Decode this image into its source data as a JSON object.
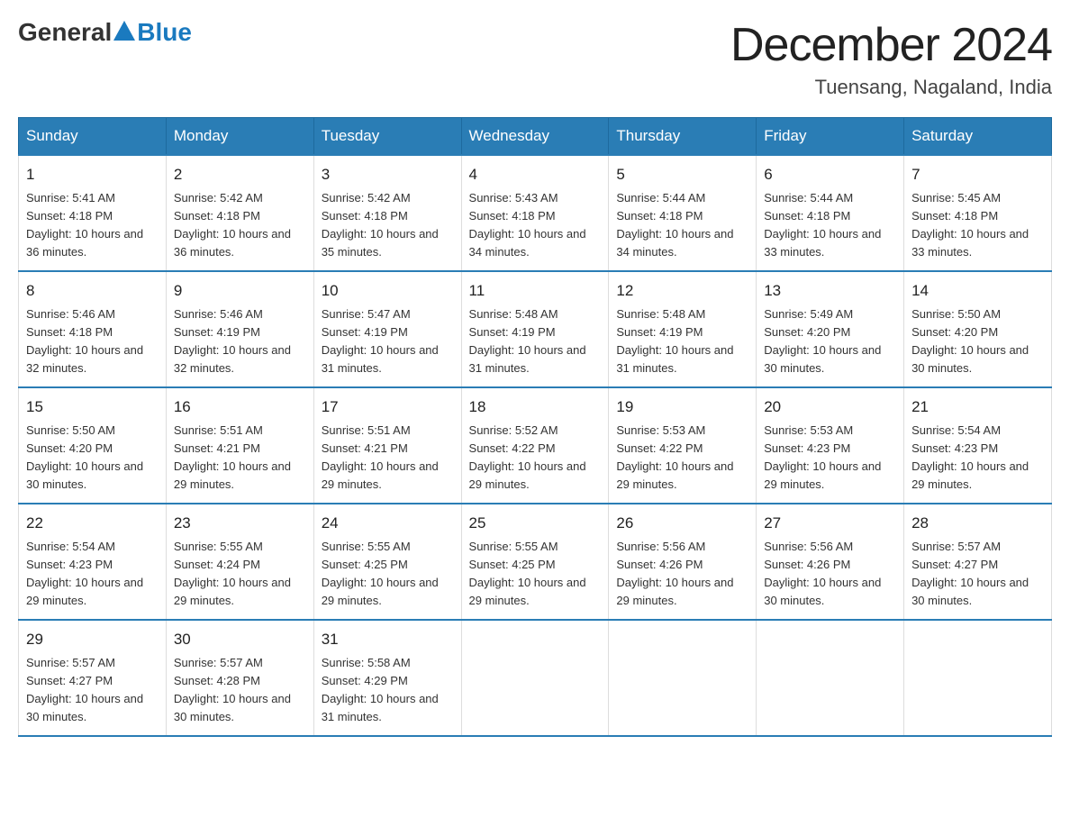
{
  "header": {
    "logo_general": "General",
    "logo_blue": "Blue",
    "month_title": "December 2024",
    "location": "Tuensang, Nagaland, India"
  },
  "weekdays": [
    "Sunday",
    "Monday",
    "Tuesday",
    "Wednesday",
    "Thursday",
    "Friday",
    "Saturday"
  ],
  "weeks": [
    [
      {
        "day": "1",
        "sunrise": "5:41 AM",
        "sunset": "4:18 PM",
        "daylight": "10 hours and 36 minutes."
      },
      {
        "day": "2",
        "sunrise": "5:42 AM",
        "sunset": "4:18 PM",
        "daylight": "10 hours and 36 minutes."
      },
      {
        "day": "3",
        "sunrise": "5:42 AM",
        "sunset": "4:18 PM",
        "daylight": "10 hours and 35 minutes."
      },
      {
        "day": "4",
        "sunrise": "5:43 AM",
        "sunset": "4:18 PM",
        "daylight": "10 hours and 34 minutes."
      },
      {
        "day": "5",
        "sunrise": "5:44 AM",
        "sunset": "4:18 PM",
        "daylight": "10 hours and 34 minutes."
      },
      {
        "day": "6",
        "sunrise": "5:44 AM",
        "sunset": "4:18 PM",
        "daylight": "10 hours and 33 minutes."
      },
      {
        "day": "7",
        "sunrise": "5:45 AM",
        "sunset": "4:18 PM",
        "daylight": "10 hours and 33 minutes."
      }
    ],
    [
      {
        "day": "8",
        "sunrise": "5:46 AM",
        "sunset": "4:18 PM",
        "daylight": "10 hours and 32 minutes."
      },
      {
        "day": "9",
        "sunrise": "5:46 AM",
        "sunset": "4:19 PM",
        "daylight": "10 hours and 32 minutes."
      },
      {
        "day": "10",
        "sunrise": "5:47 AM",
        "sunset": "4:19 PM",
        "daylight": "10 hours and 31 minutes."
      },
      {
        "day": "11",
        "sunrise": "5:48 AM",
        "sunset": "4:19 PM",
        "daylight": "10 hours and 31 minutes."
      },
      {
        "day": "12",
        "sunrise": "5:48 AM",
        "sunset": "4:19 PM",
        "daylight": "10 hours and 31 minutes."
      },
      {
        "day": "13",
        "sunrise": "5:49 AM",
        "sunset": "4:20 PM",
        "daylight": "10 hours and 30 minutes."
      },
      {
        "day": "14",
        "sunrise": "5:50 AM",
        "sunset": "4:20 PM",
        "daylight": "10 hours and 30 minutes."
      }
    ],
    [
      {
        "day": "15",
        "sunrise": "5:50 AM",
        "sunset": "4:20 PM",
        "daylight": "10 hours and 30 minutes."
      },
      {
        "day": "16",
        "sunrise": "5:51 AM",
        "sunset": "4:21 PM",
        "daylight": "10 hours and 29 minutes."
      },
      {
        "day": "17",
        "sunrise": "5:51 AM",
        "sunset": "4:21 PM",
        "daylight": "10 hours and 29 minutes."
      },
      {
        "day": "18",
        "sunrise": "5:52 AM",
        "sunset": "4:22 PM",
        "daylight": "10 hours and 29 minutes."
      },
      {
        "day": "19",
        "sunrise": "5:53 AM",
        "sunset": "4:22 PM",
        "daylight": "10 hours and 29 minutes."
      },
      {
        "day": "20",
        "sunrise": "5:53 AM",
        "sunset": "4:23 PM",
        "daylight": "10 hours and 29 minutes."
      },
      {
        "day": "21",
        "sunrise": "5:54 AM",
        "sunset": "4:23 PM",
        "daylight": "10 hours and 29 minutes."
      }
    ],
    [
      {
        "day": "22",
        "sunrise": "5:54 AM",
        "sunset": "4:23 PM",
        "daylight": "10 hours and 29 minutes."
      },
      {
        "day": "23",
        "sunrise": "5:55 AM",
        "sunset": "4:24 PM",
        "daylight": "10 hours and 29 minutes."
      },
      {
        "day": "24",
        "sunrise": "5:55 AM",
        "sunset": "4:25 PM",
        "daylight": "10 hours and 29 minutes."
      },
      {
        "day": "25",
        "sunrise": "5:55 AM",
        "sunset": "4:25 PM",
        "daylight": "10 hours and 29 minutes."
      },
      {
        "day": "26",
        "sunrise": "5:56 AM",
        "sunset": "4:26 PM",
        "daylight": "10 hours and 29 minutes."
      },
      {
        "day": "27",
        "sunrise": "5:56 AM",
        "sunset": "4:26 PM",
        "daylight": "10 hours and 30 minutes."
      },
      {
        "day": "28",
        "sunrise": "5:57 AM",
        "sunset": "4:27 PM",
        "daylight": "10 hours and 30 minutes."
      }
    ],
    [
      {
        "day": "29",
        "sunrise": "5:57 AM",
        "sunset": "4:27 PM",
        "daylight": "10 hours and 30 minutes."
      },
      {
        "day": "30",
        "sunrise": "5:57 AM",
        "sunset": "4:28 PM",
        "daylight": "10 hours and 30 minutes."
      },
      {
        "day": "31",
        "sunrise": "5:58 AM",
        "sunset": "4:29 PM",
        "daylight": "10 hours and 31 minutes."
      },
      null,
      null,
      null,
      null
    ]
  ]
}
